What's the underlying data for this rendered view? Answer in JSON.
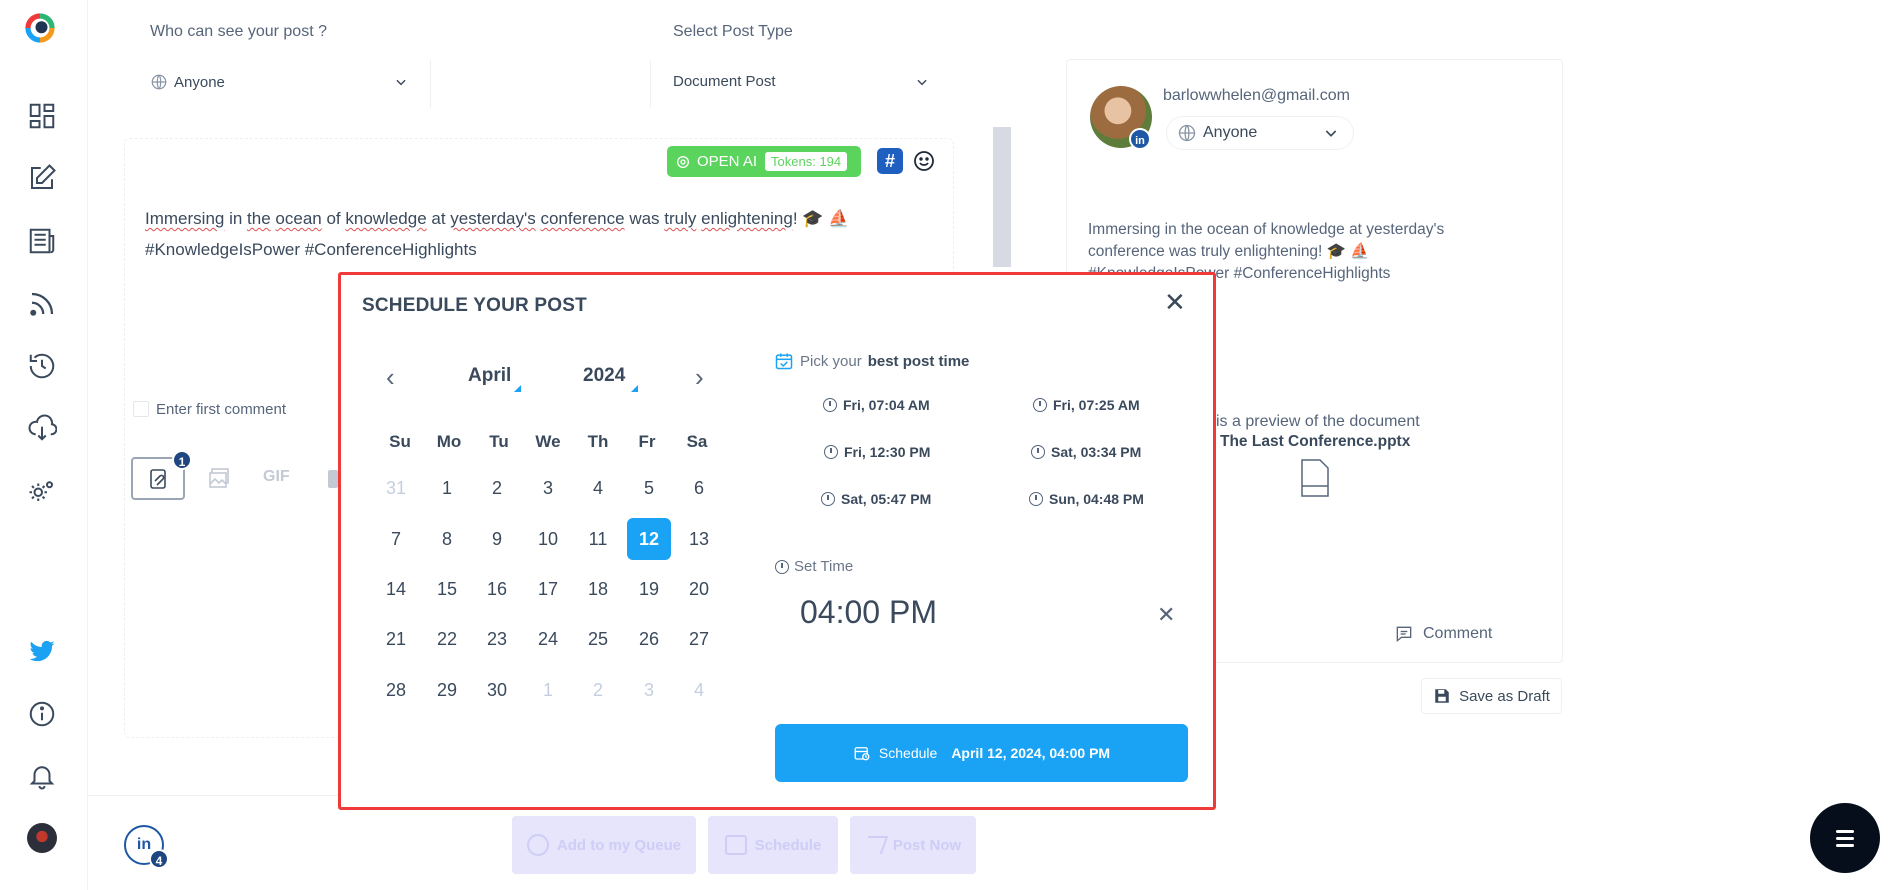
{
  "sidebar": {
    "icons": [
      "logo",
      "dashboard-icon",
      "edit-icon",
      "newspaper-icon",
      "rss-icon",
      "history-icon",
      "cloud-download-icon",
      "settings-icon",
      "twitter-icon",
      "info-icon",
      "bell-icon",
      "profile-avatar"
    ]
  },
  "composer": {
    "visibility_label": "Who can see your post ?",
    "visibility_value": "Anyone",
    "post_type_label": "Select Post Type",
    "post_type_value": "Document Post",
    "ai_label": "OPEN AI",
    "tokens_label": "Tokens: 194",
    "hashtag_label": "#",
    "post_line1": "Immersing in the ocean of knowledge at yesterday's conference was truly enlightening! 🎓 ⛵",
    "post_line1_words": [
      "Immersing",
      " in ",
      "the",
      " ",
      "ocean",
      " of ",
      "knowledge",
      " at ",
      "yesterday's",
      " ",
      "conference",
      " was ",
      "truly",
      " ",
      "enlightening",
      "!  🎓 ⛵"
    ],
    "post_line2": "#KnowledgeIsPower #ConferenceHighlights",
    "first_comment_label": "Enter first comment",
    "media_badge": "1",
    "gif_label": "GIF"
  },
  "preview": {
    "email": "barlowwhelen@gmail.com",
    "audience": "Anyone",
    "text_line1": "Immersing in the ocean of knowledge at yesterday's",
    "text_line2": "conference was truly enlightening! 🎓 ⛵",
    "text_line3": "#KnowledgeIsPower #ConferenceHighlights",
    "doc_note": "is is a preview of the document",
    "doc_name": "The Last Conference.pptx",
    "comment_label": "Comment",
    "save_draft_label": "Save as Draft"
  },
  "bottom_bar": {
    "account_badge": "4",
    "queue_label": "Add to my Queue",
    "schedule_label": "Schedule",
    "post_now_label": "Post Now"
  },
  "modal": {
    "title": "SCHEDULE YOUR POST",
    "month": "April",
    "year": "2024",
    "weekdays": [
      "Su",
      "Mo",
      "Tu",
      "We",
      "Th",
      "Fr",
      "Sa"
    ],
    "weeks": [
      [
        "31",
        "1",
        "2",
        "3",
        "4",
        "5",
        "6"
      ],
      [
        "7",
        "8",
        "9",
        "10",
        "11",
        "12",
        "13"
      ],
      [
        "14",
        "15",
        "16",
        "17",
        "18",
        "19",
        "20"
      ],
      [
        "21",
        "22",
        "23",
        "24",
        "25",
        "26",
        "27"
      ],
      [
        "28",
        "29",
        "30",
        "1",
        "2",
        "3",
        "4"
      ]
    ],
    "selected_day": "12",
    "pick_prefix": "Pick your",
    "pick_bold": "best post time",
    "best_times": [
      "Fri, 07:04 AM",
      "Fri, 07:25 AM",
      "Fri, 12:30 PM",
      "Sat, 03:34 PM",
      "Sat, 05:47 PM",
      "Sun, 04:48 PM"
    ],
    "set_time_label": "Set Time",
    "time_value": "04:00 PM",
    "schedule_prefix": "Schedule",
    "schedule_datetime": "April 12, 2024, 04:00 PM"
  },
  "colors": {
    "accent": "#1aa3f5",
    "ai_green": "#5bd45d",
    "modal_border": "#f03a3a",
    "linkedin": "#1d57a6"
  }
}
